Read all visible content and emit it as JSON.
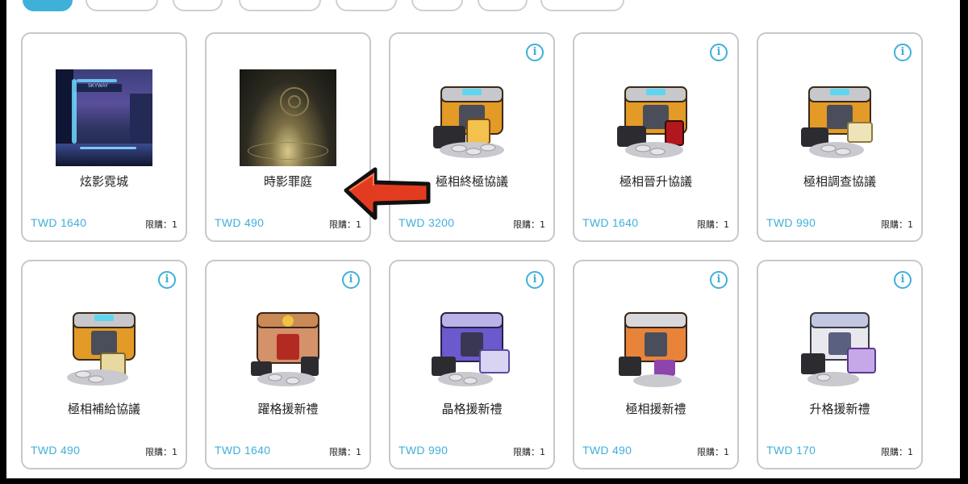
{
  "accent_color": "#3eb0d9",
  "products": [
    {
      "name": "炫影霓城",
      "price": "TWD 1640",
      "limit": "限購：1",
      "thumb": "city-scene",
      "has_info": false
    },
    {
      "name": "時影罪庭",
      "price": "TWD 490",
      "limit": "限購：1",
      "thumb": "court-scene",
      "has_info": false
    },
    {
      "name": "極相終極協議",
      "price": "TWD 3200",
      "limit": "限購：1",
      "thumb": "gold-crate",
      "has_info": true
    },
    {
      "name": "極相晉升協議",
      "price": "TWD 1640",
      "limit": "限購：1",
      "thumb": "gold-crate",
      "has_info": true
    },
    {
      "name": "極相調查協議",
      "price": "TWD 990",
      "limit": "限購：1",
      "thumb": "gold-crate",
      "has_info": true
    },
    {
      "name": "極相補給協議",
      "price": "TWD 490",
      "limit": "限購：1",
      "thumb": "gold-crate",
      "has_info": true
    },
    {
      "name": "躍格援新禮",
      "price": "TWD 1640",
      "limit": "限購：1",
      "thumb": "bronze-crate",
      "has_info": true
    },
    {
      "name": "晶格援新禮",
      "price": "TWD 990",
      "limit": "限購：1",
      "thumb": "purple-crate",
      "has_info": true
    },
    {
      "name": "極相援新禮",
      "price": "TWD 490",
      "limit": "限購：1",
      "thumb": "orange-crate",
      "has_info": true
    },
    {
      "name": "升格援新禮",
      "price": "TWD 170",
      "limit": "限購：1",
      "thumb": "silver-crate",
      "has_info": true
    }
  ]
}
